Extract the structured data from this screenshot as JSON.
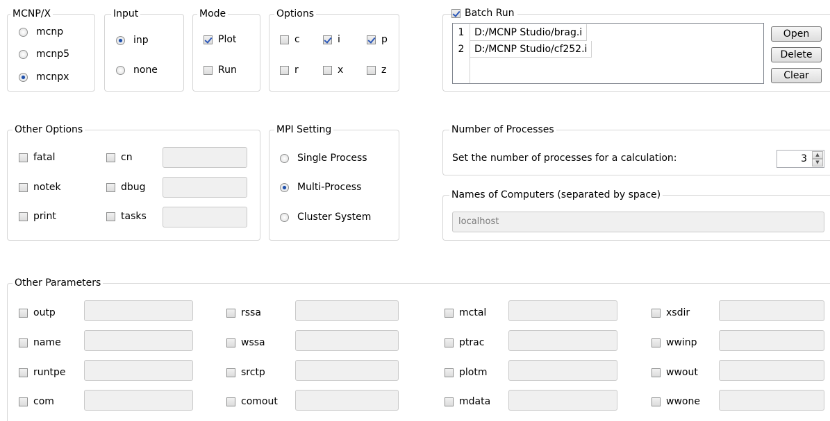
{
  "mcnpx": {
    "title": "MCNP/X",
    "options": [
      "mcnp",
      "mcnp5",
      "mcnpx"
    ],
    "selected": "mcnpx"
  },
  "input": {
    "title": "Input",
    "options": [
      "inp",
      "none"
    ],
    "selected": "inp"
  },
  "mode": {
    "title": "Mode",
    "plot": "Plot",
    "run": "Run",
    "plot_checked": true,
    "run_checked": false
  },
  "options": {
    "title": "Options",
    "items": [
      {
        "label": "c",
        "checked": false
      },
      {
        "label": "i",
        "checked": true
      },
      {
        "label": "p",
        "checked": true
      },
      {
        "label": "r",
        "checked": false
      },
      {
        "label": "x",
        "checked": false
      },
      {
        "label": "z",
        "checked": false
      }
    ]
  },
  "batch": {
    "title": "Batch Run",
    "checked": true,
    "files": [
      {
        "num": "1",
        "path": "D:/MCNP Studio/brag.i"
      },
      {
        "num": "2",
        "path": "D:/MCNP Studio/cf252.i"
      }
    ],
    "open": "Open",
    "delete": "Delete",
    "clear": "Clear"
  },
  "other_options": {
    "title": "Other Options",
    "items": [
      "fatal",
      "notek",
      "print",
      "cn",
      "dbug",
      "tasks"
    ]
  },
  "mpi": {
    "title": "MPI Setting",
    "options": [
      "Single Process",
      "Multi-Process",
      "Cluster System"
    ],
    "selected": "Multi-Process"
  },
  "processes": {
    "title": "Number of Processes",
    "label": "Set the number of processes for a calculation:",
    "value": "3"
  },
  "computers": {
    "title": "Names of Computers (separated by space)",
    "value": "localhost"
  },
  "other_params": {
    "title": "Other Parameters",
    "columns": [
      [
        "outp",
        "name",
        "runtpe",
        "com"
      ],
      [
        "rssa",
        "wssa",
        "srctp",
        "comout"
      ],
      [
        "mctal",
        "ptrac",
        "plotm",
        "mdata"
      ],
      [
        "xsdir",
        "wwinp",
        "wwout",
        "wwone"
      ]
    ]
  }
}
